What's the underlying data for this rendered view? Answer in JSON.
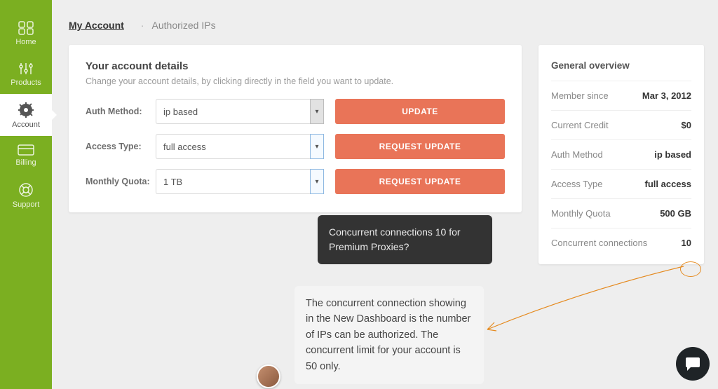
{
  "sidebar": {
    "items": [
      {
        "name": "home",
        "label": "Home"
      },
      {
        "name": "products",
        "label": "Products"
      },
      {
        "name": "account",
        "label": "Account"
      },
      {
        "name": "billing",
        "label": "Billing"
      },
      {
        "name": "support",
        "label": "Support"
      }
    ],
    "active_index": 2
  },
  "breadcrumb": {
    "current": "My Account",
    "secondary": "Authorized IPs",
    "separator": "·"
  },
  "details": {
    "title": "Your account details",
    "subtitle": "Change your account details, by clicking directly in the field you want to update.",
    "rows": [
      {
        "label": "Auth Method:",
        "value": "ip based",
        "button": "UPDATE"
      },
      {
        "label": "Access Type:",
        "value": "full access",
        "button": "REQUEST UPDATE"
      },
      {
        "label": "Monthly Quota:",
        "value": "1 TB",
        "button": "REQUEST UPDATE"
      }
    ]
  },
  "overview": {
    "title": "General overview",
    "rows": [
      {
        "key": "Member since",
        "value": "Mar 3, 2012"
      },
      {
        "key": "Current Credit",
        "value": "$0"
      },
      {
        "key": "Auth Method",
        "value": "ip based"
      },
      {
        "key": "Access Type",
        "value": "full access"
      },
      {
        "key": "Monthly Quota",
        "value": "500 GB"
      },
      {
        "key": "Concurrent connections",
        "value": "10"
      }
    ]
  },
  "chat": {
    "question": "Concurrent connections 10 for Premium Proxies?",
    "answer": "The concurrent connection showing in the New Dashboard is the number of IPs can be authorized. The concurrent limit for your account is 50 only."
  },
  "colors": {
    "sidebar_bg": "#7baf21",
    "accent_button": "#e97458",
    "highlight_circle": "#e58a1f"
  }
}
